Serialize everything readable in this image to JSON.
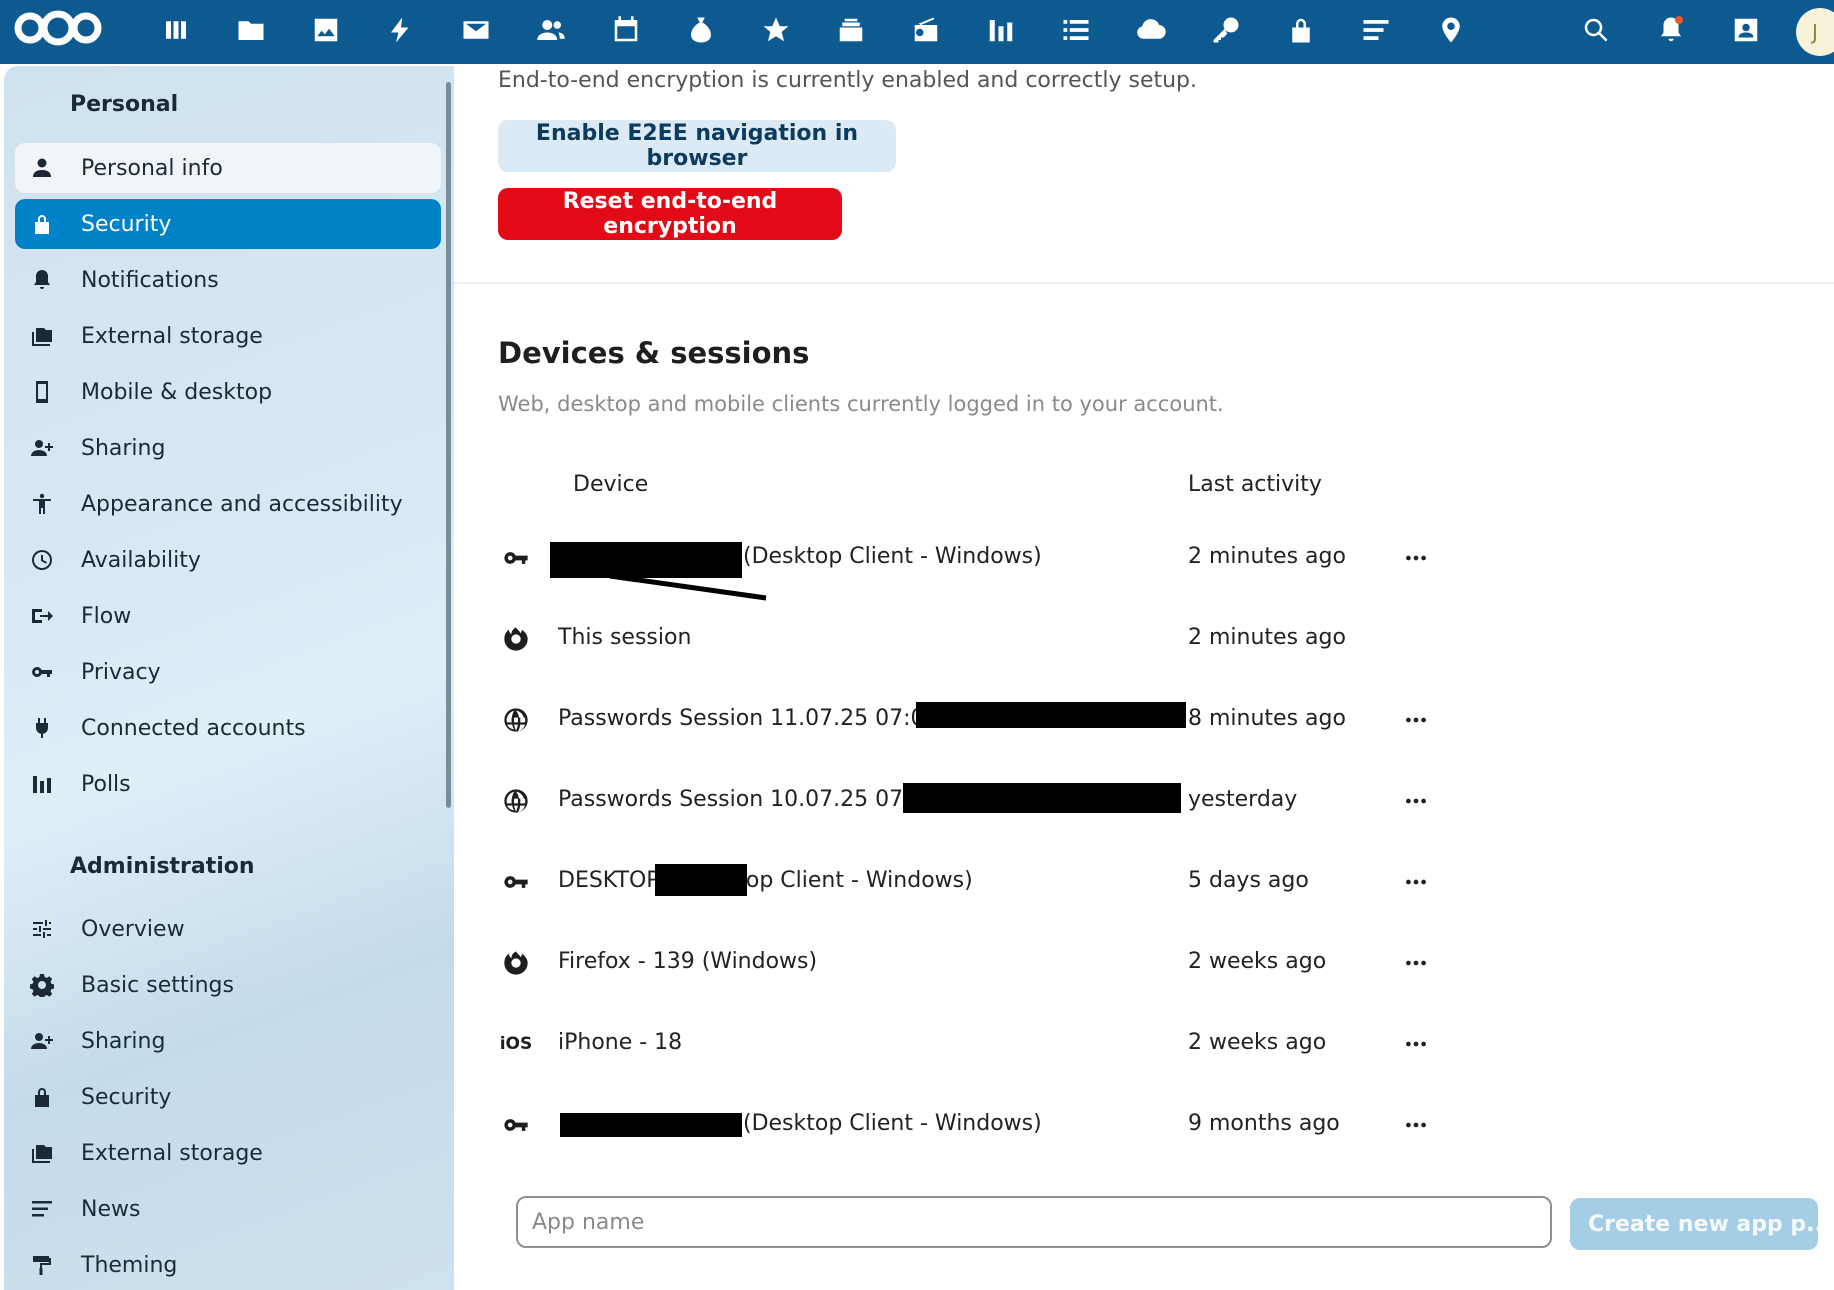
{
  "topbar": {
    "brand_color": "#0d5a91",
    "apps": [
      "dashboard-icon",
      "files-icon",
      "photos-icon",
      "activity-icon",
      "mail-icon",
      "contacts-icon",
      "calendar-icon",
      "cospend-icon",
      "favorites-icon",
      "deck-icon",
      "radio-icon",
      "analytics-icon",
      "tasks-icon",
      "cloud-icon",
      "passwords-icon",
      "lock-icon",
      "news-icon",
      "maps-icon"
    ],
    "right_icons": [
      "search-icon",
      "notifications-icon",
      "contacts-menu-icon"
    ],
    "avatar_initial": "J"
  },
  "sidebar": {
    "personal_title": "Personal",
    "personal_items": [
      {
        "label": "Personal info",
        "icon": "user-icon",
        "state": "hover"
      },
      {
        "label": "Security",
        "icon": "lock-icon",
        "state": "active"
      },
      {
        "label": "Notifications",
        "icon": "bell-icon",
        "state": ""
      },
      {
        "label": "External storage",
        "icon": "external-storage-icon",
        "state": ""
      },
      {
        "label": "Mobile & desktop",
        "icon": "phone-icon",
        "state": ""
      },
      {
        "label": "Sharing",
        "icon": "share-user-icon",
        "state": ""
      },
      {
        "label": "Appearance and accessibility",
        "icon": "accessibility-icon",
        "state": ""
      },
      {
        "label": "Availability",
        "icon": "clock-icon",
        "state": ""
      },
      {
        "label": "Flow",
        "icon": "flow-icon",
        "state": ""
      },
      {
        "label": "Privacy",
        "icon": "key-icon",
        "state": ""
      },
      {
        "label": "Connected accounts",
        "icon": "plug-icon",
        "state": ""
      },
      {
        "label": "Polls",
        "icon": "polls-icon",
        "state": ""
      }
    ],
    "admin_title": "Administration",
    "admin_items": [
      {
        "label": "Overview",
        "icon": "tune-icon"
      },
      {
        "label": "Basic settings",
        "icon": "cog-icon"
      },
      {
        "label": "Sharing",
        "icon": "share-user-icon"
      },
      {
        "label": "Security",
        "icon": "lock-icon"
      },
      {
        "label": "External storage",
        "icon": "external-storage-icon"
      },
      {
        "label": "News",
        "icon": "news-icon"
      },
      {
        "label": "Theming",
        "icon": "paint-roller-icon"
      }
    ]
  },
  "main": {
    "e2ee_status": "End-to-end encryption is currently enabled and correctly setup.",
    "e2ee_button": "Enable E2EE navigation in browser",
    "reset_button": "Reset end-to-end encryption",
    "danger_color": "#e30a17",
    "devices_title": "Devices & sessions",
    "devices_description": "Web, desktop and mobile clients currently logged in to your account.",
    "col_device": "Device",
    "col_last_activity": "Last activity",
    "sessions": [
      {
        "icon": "key-icon",
        "name": "(Desktop Client - Windows)",
        "last_activity": "2 minutes ago",
        "has_menu": true
      },
      {
        "icon": "firefox-icon",
        "name": "This session",
        "last_activity": "2 minutes ago",
        "has_menu": false
      },
      {
        "icon": "globe-icon",
        "name": "Passwords Session 11.07.25 07:07 - ",
        "last_activity": "8 minutes ago",
        "has_menu": true
      },
      {
        "icon": "globe-icon",
        "name": "Passwords Session 10.07.25 07:25 -",
        "last_activity": "yesterday",
        "has_menu": true
      },
      {
        "icon": "key-icon",
        "name": "DESKTOP-                 (Desktop Client - Windows)",
        "last_activity": "5 days ago",
        "has_menu": true
      },
      {
        "icon": "firefox-icon",
        "name": "Firefox - 139 (Windows)",
        "last_activity": "2 weeks ago",
        "has_menu": true
      },
      {
        "icon": "ios-icon",
        "icon_text": "iOS",
        "name": "iPhone - 18",
        "last_activity": "2 weeks ago",
        "has_menu": true
      },
      {
        "icon": "key-icon",
        "name": "(Desktop Client - Windows)",
        "last_activity": "9 months ago",
        "has_menu": true
      }
    ],
    "app_name_placeholder": "App name",
    "create_button": "Create new app p..."
  }
}
